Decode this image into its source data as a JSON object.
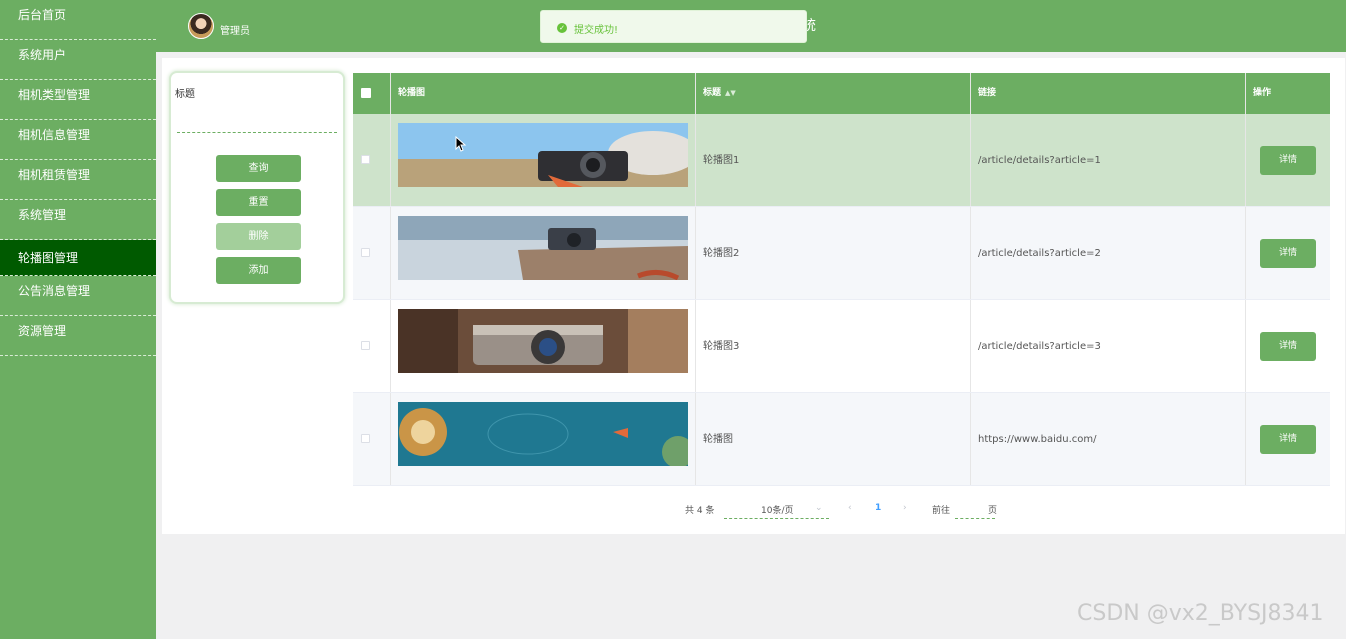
{
  "sidebar": {
    "items": [
      {
        "label": "后台首页"
      },
      {
        "label": "系统用户"
      },
      {
        "label": "相机类型管理"
      },
      {
        "label": "相机信息管理"
      },
      {
        "label": "相机租赁管理"
      },
      {
        "label": "系统管理"
      },
      {
        "label": "轮播图管理"
      },
      {
        "label": "公告消息管理"
      },
      {
        "label": "资源管理"
      }
    ],
    "active_index": 6
  },
  "header": {
    "admin_name": "管理员",
    "title_fragment": "统"
  },
  "toast": {
    "message": "提交成功!",
    "icon": "check-circle-icon"
  },
  "search": {
    "label": "标题",
    "value": "",
    "buttons": {
      "query": "查询",
      "reset": "重置",
      "delete": "删除",
      "add": "添加"
    }
  },
  "table": {
    "headers": [
      "轮播图",
      "标题",
      "链接",
      "操作"
    ],
    "rows": [
      {
        "title": "轮播图1",
        "link": "/article/details?article=1",
        "action": "详情",
        "image": "camera-on-beach"
      },
      {
        "title": "轮播图2",
        "link": "/article/details?article=2",
        "action": "详情",
        "image": "camera-on-rock"
      },
      {
        "title": "轮播图3",
        "link": "/article/details?article=3",
        "action": "详情",
        "image": "vintage-camera"
      },
      {
        "title": "轮播图",
        "link": "https://www.baidu.com/",
        "action": "详情",
        "image": "teal-illustration"
      }
    ]
  },
  "pagination": {
    "total": "共 4 条",
    "page_size": "10条/页",
    "current_page": "1",
    "goto_prefix": "前往",
    "goto_suffix": "页"
  },
  "watermark": "CSDN @vx2_BYSJ8341",
  "colors": {
    "primary": "#6cae62",
    "active_nav": "#005a00",
    "row_hover": "#cee3cb"
  }
}
